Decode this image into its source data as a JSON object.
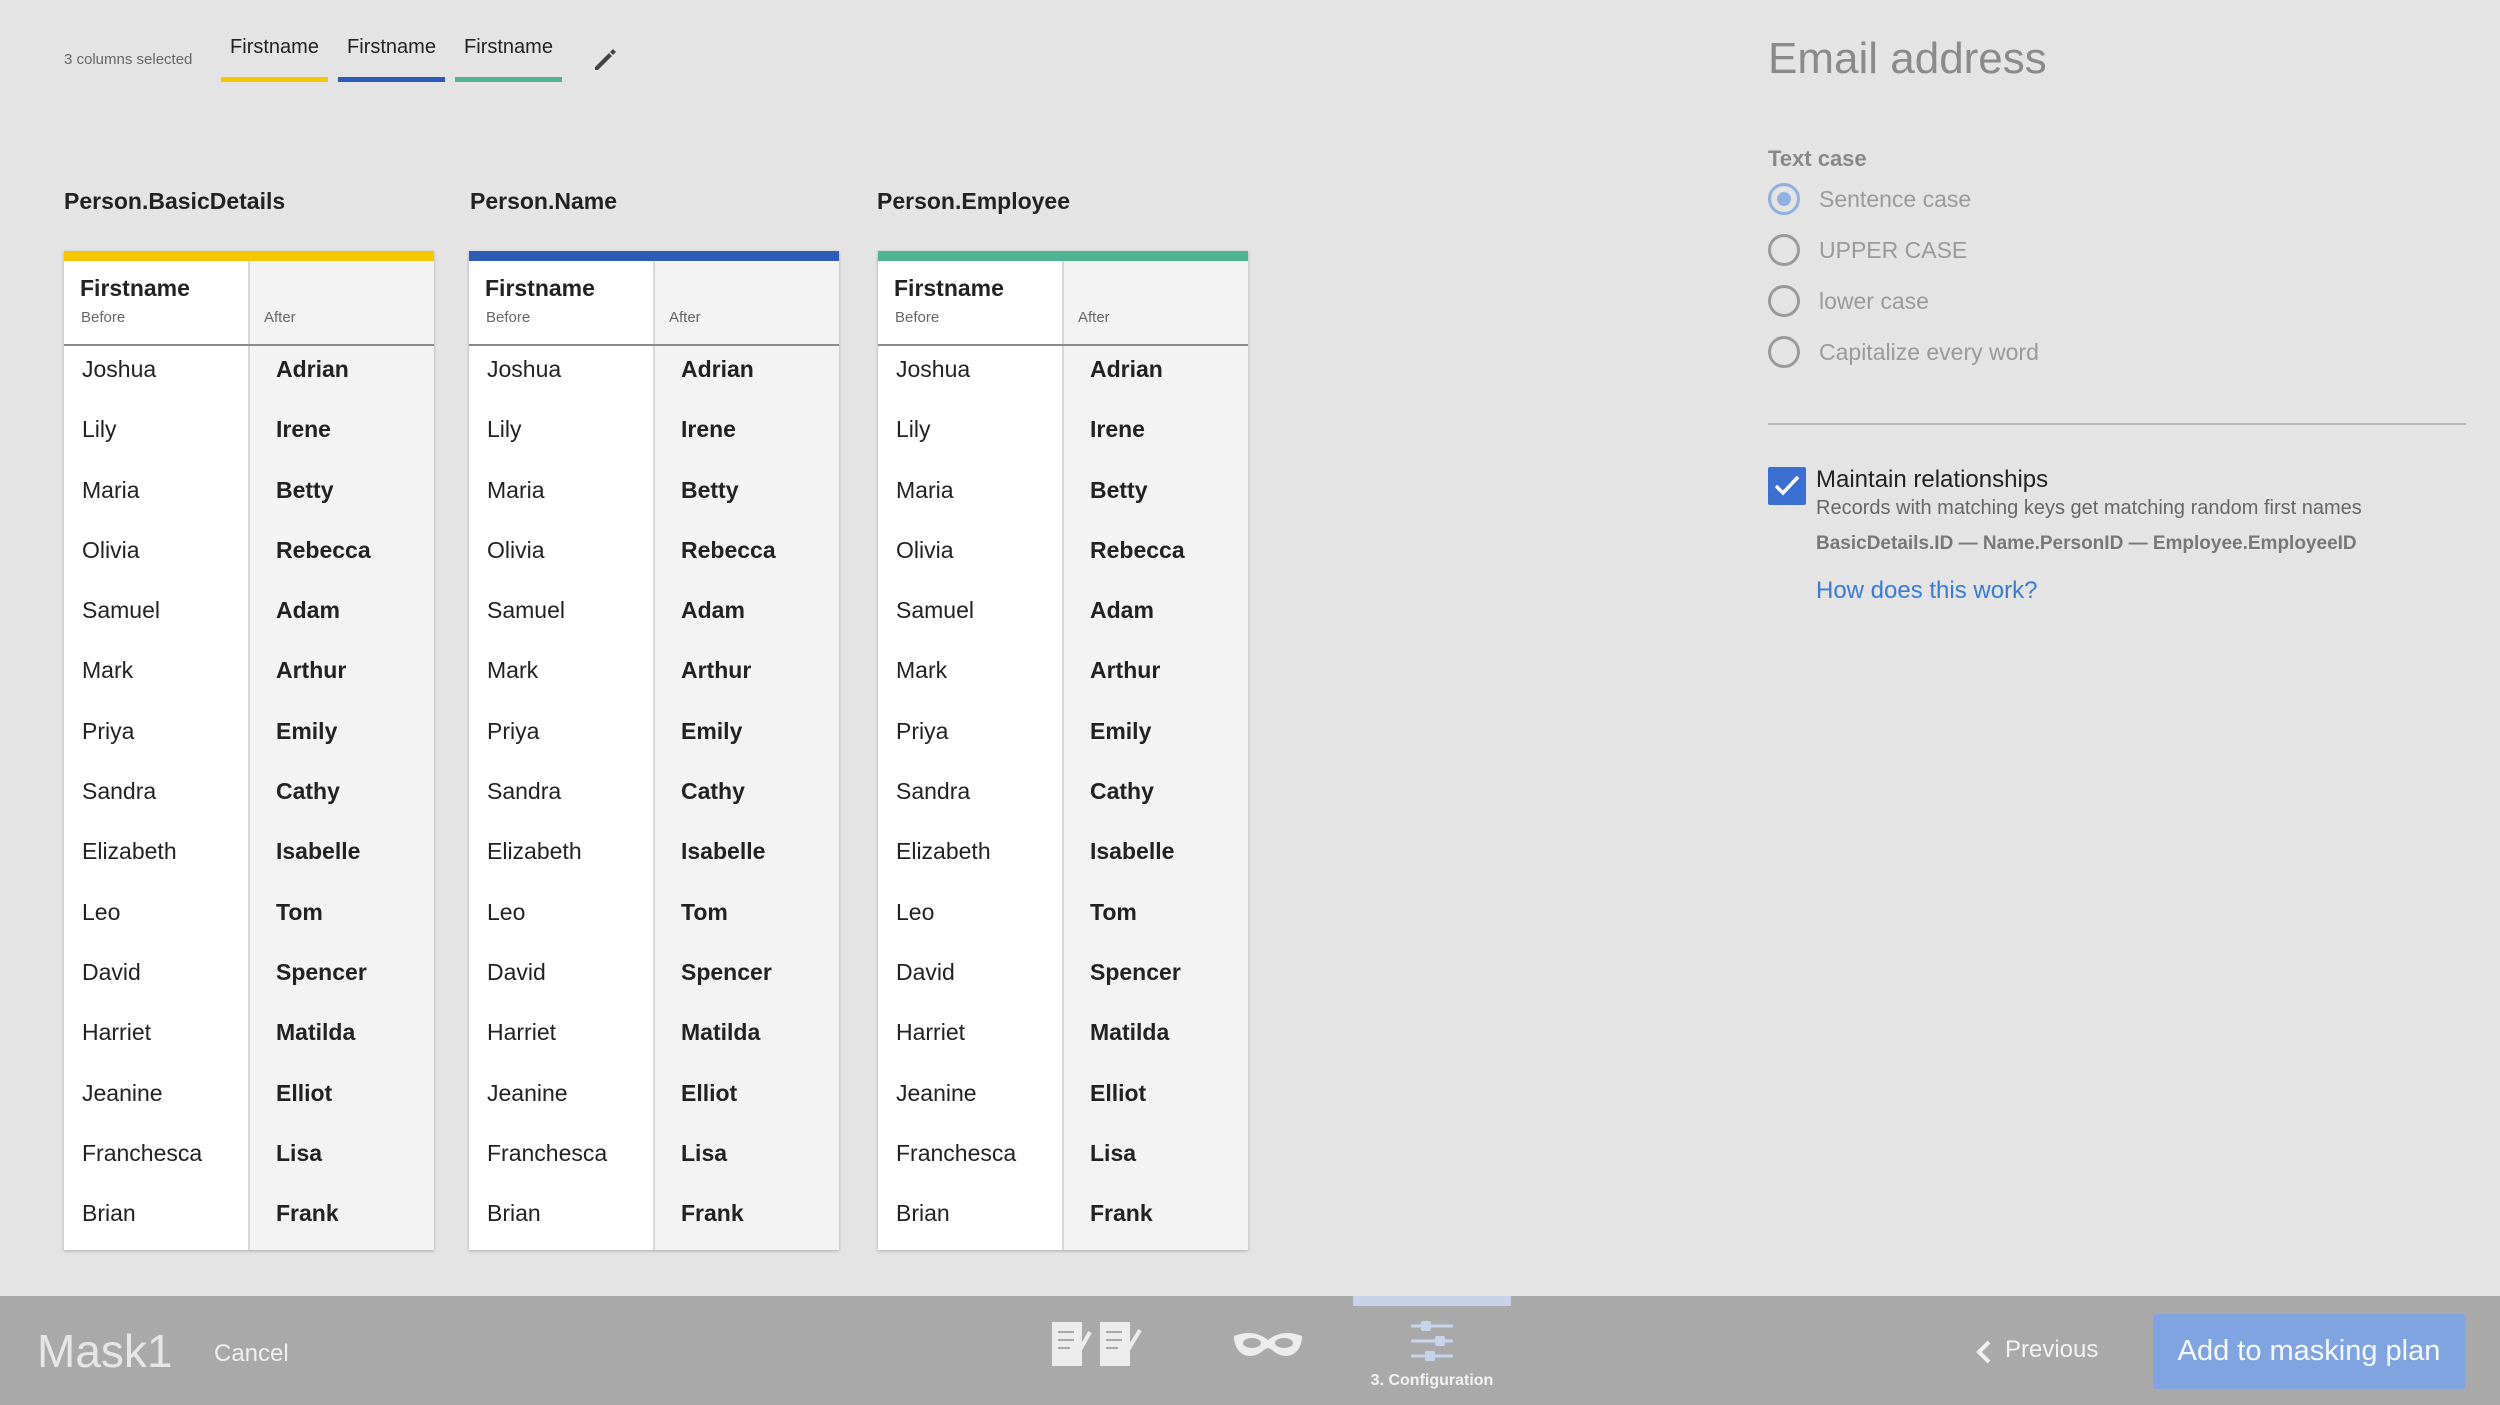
{
  "selection": {
    "count_label": "3 columns selected",
    "tabs": [
      {
        "label": "Firstname",
        "color": "#f5c800"
      },
      {
        "label": "Firstname",
        "color": "#2e5bb8"
      },
      {
        "label": "Firstname",
        "color": "#4db392"
      }
    ],
    "edit_icon": "pencil-icon"
  },
  "groups": [
    {
      "title": "Person.BasicDetails",
      "color": "#f5c800",
      "column": "Firstname",
      "before_label": "Before",
      "after_label": "After",
      "rows": [
        [
          "Joshua",
          "Adrian"
        ],
        [
          "Lily",
          "Irene"
        ],
        [
          "Maria",
          "Betty"
        ],
        [
          "Olivia",
          "Rebecca"
        ],
        [
          "Samuel",
          "Adam"
        ],
        [
          "Mark",
          "Arthur"
        ],
        [
          "Priya",
          "Emily"
        ],
        [
          "Sandra",
          "Cathy"
        ],
        [
          "Elizabeth",
          "Isabelle"
        ],
        [
          "Leo",
          "Tom"
        ],
        [
          "David",
          "Spencer"
        ],
        [
          "Harriet",
          "Matilda"
        ],
        [
          "Jeanine",
          "Elliot"
        ],
        [
          "Franchesca",
          "Lisa"
        ],
        [
          "Brian",
          "Frank"
        ]
      ]
    },
    {
      "title": "Person.Name",
      "color": "#2e5bb8",
      "column": "Firstname",
      "before_label": "Before",
      "after_label": "After",
      "rows": [
        [
          "Joshua",
          "Adrian"
        ],
        [
          "Lily",
          "Irene"
        ],
        [
          "Maria",
          "Betty"
        ],
        [
          "Olivia",
          "Rebecca"
        ],
        [
          "Samuel",
          "Adam"
        ],
        [
          "Mark",
          "Arthur"
        ],
        [
          "Priya",
          "Emily"
        ],
        [
          "Sandra",
          "Cathy"
        ],
        [
          "Elizabeth",
          "Isabelle"
        ],
        [
          "Leo",
          "Tom"
        ],
        [
          "David",
          "Spencer"
        ],
        [
          "Harriet",
          "Matilda"
        ],
        [
          "Jeanine",
          "Elliot"
        ],
        [
          "Franchesca",
          "Lisa"
        ],
        [
          "Brian",
          "Frank"
        ]
      ]
    },
    {
      "title": "Person.Employee",
      "color": "#4db392",
      "column": "Firstname",
      "before_label": "Before",
      "after_label": "After",
      "rows": [
        [
          "Joshua",
          "Adrian"
        ],
        [
          "Lily",
          "Irene"
        ],
        [
          "Maria",
          "Betty"
        ],
        [
          "Olivia",
          "Rebecca"
        ],
        [
          "Samuel",
          "Adam"
        ],
        [
          "Mark",
          "Arthur"
        ],
        [
          "Priya",
          "Emily"
        ],
        [
          "Sandra",
          "Cathy"
        ],
        [
          "Elizabeth",
          "Isabelle"
        ],
        [
          "Leo",
          "Tom"
        ],
        [
          "David",
          "Spencer"
        ],
        [
          "Harriet",
          "Matilda"
        ],
        [
          "Jeanine",
          "Elliot"
        ],
        [
          "Franchesca",
          "Lisa"
        ],
        [
          "Brian",
          "Frank"
        ]
      ]
    }
  ],
  "panel": {
    "title": "Email address",
    "text_case_label": "Text case",
    "text_case_options": [
      "Sentence case",
      "UPPER CASE",
      "lower case",
      "Capitalize every word"
    ],
    "text_case_selected": "Sentence case",
    "maintain_label": "Maintain relationships",
    "maintain_checked": true,
    "maintain_desc": "Records with matching keys get matching random first names",
    "maintain_keys": "BasicDetails.ID — Name.PersonID — Employee.EmployeeID",
    "help_link": "How does this work?"
  },
  "footer": {
    "title": "Mask1",
    "cancel": "Cancel",
    "steps": [
      {
        "icon": "documents-check-icon"
      },
      {
        "icon": "mask-icon"
      },
      {
        "icon": "sliders-icon",
        "label": "3. Configuration",
        "active": true
      }
    ],
    "previous": "Previous",
    "primary": "Add to masking plan"
  }
}
